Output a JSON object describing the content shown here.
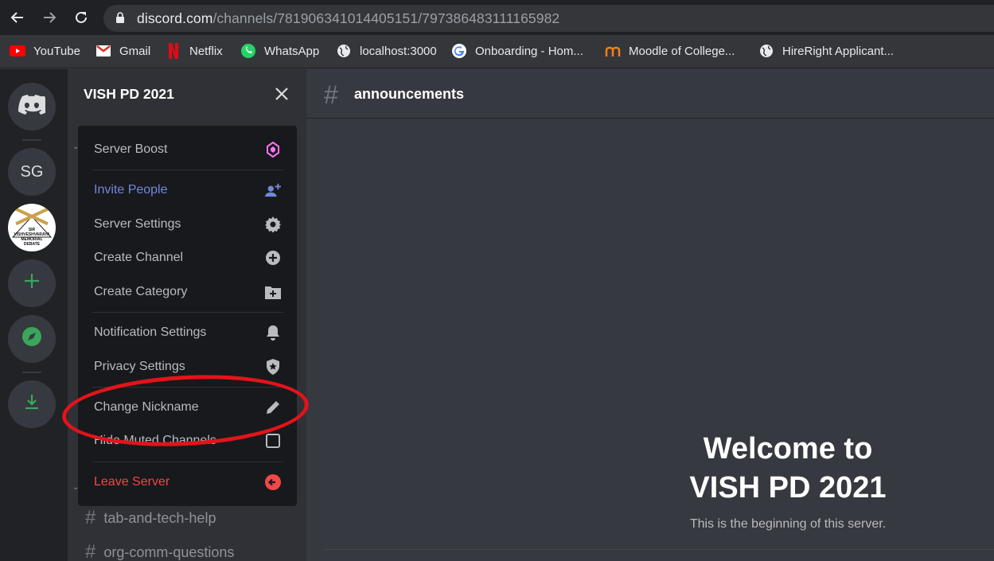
{
  "browser": {
    "url_host": "discord.com",
    "url_path": "/channels/781906341014405151/797386483111165982",
    "bookmarks": [
      {
        "label": "YouTube",
        "icon": "youtube-icon"
      },
      {
        "label": "Gmail",
        "icon": "gmail-icon"
      },
      {
        "label": "Netflix",
        "icon": "netflix-icon"
      },
      {
        "label": "WhatsApp",
        "icon": "whatsapp-icon"
      },
      {
        "label": "localhost:3000",
        "icon": "globe-icon"
      },
      {
        "label": "Onboarding - Hom...",
        "icon": "google-icon"
      },
      {
        "label": "Moodle of College...",
        "icon": "moodle-icon"
      },
      {
        "label": "HireRight Applicant...",
        "icon": "globe-icon"
      }
    ]
  },
  "guilds": {
    "sg_label": "SG",
    "server_logo_text": [
      "SIR",
      "VISHVESHVARAYA",
      "MEMORIAL",
      "DEBATE"
    ]
  },
  "server": {
    "name": "VISH PD 2021"
  },
  "menu": {
    "items": [
      {
        "label": "Server Boost",
        "icon": "boost-icon",
        "color": "#b9bbbe"
      },
      {
        "label": "Invite People",
        "icon": "add-person-icon",
        "color": "#7289da"
      },
      {
        "label": "Server Settings",
        "icon": "gear-icon",
        "color": "#b9bbbe"
      },
      {
        "label": "Create Channel",
        "icon": "plus-circle-icon",
        "color": "#b9bbbe"
      },
      {
        "label": "Create Category",
        "icon": "folder-plus-icon",
        "color": "#b9bbbe"
      },
      {
        "label": "Notification Settings",
        "icon": "bell-icon",
        "color": "#b9bbbe"
      },
      {
        "label": "Privacy Settings",
        "icon": "shield-star-icon",
        "color": "#b9bbbe"
      },
      {
        "label": "Change Nickname",
        "icon": "pencil-icon",
        "color": "#b9bbbe"
      },
      {
        "label": "Hide Muted Channels",
        "icon": "checkbox-icon",
        "color": "#b9bbbe"
      },
      {
        "label": "Leave Server",
        "icon": "leave-icon",
        "color": "#f04747"
      }
    ]
  },
  "channels": [
    {
      "name": "tab-and-tech-help"
    },
    {
      "name": "org-comm-questions"
    }
  ],
  "main": {
    "channel_hash": "#",
    "channel_name": "announcements",
    "welcome_line1": "Welcome to",
    "welcome_line2": "VISH PD 2021",
    "welcome_sub": "This is the beginning of this server."
  },
  "colors": {
    "accent_blurple": "#7289da",
    "boost_pink": "#ff73fa",
    "danger_red": "#f04747",
    "green": "#3ba55c",
    "annotation_red": "#e3131b"
  }
}
